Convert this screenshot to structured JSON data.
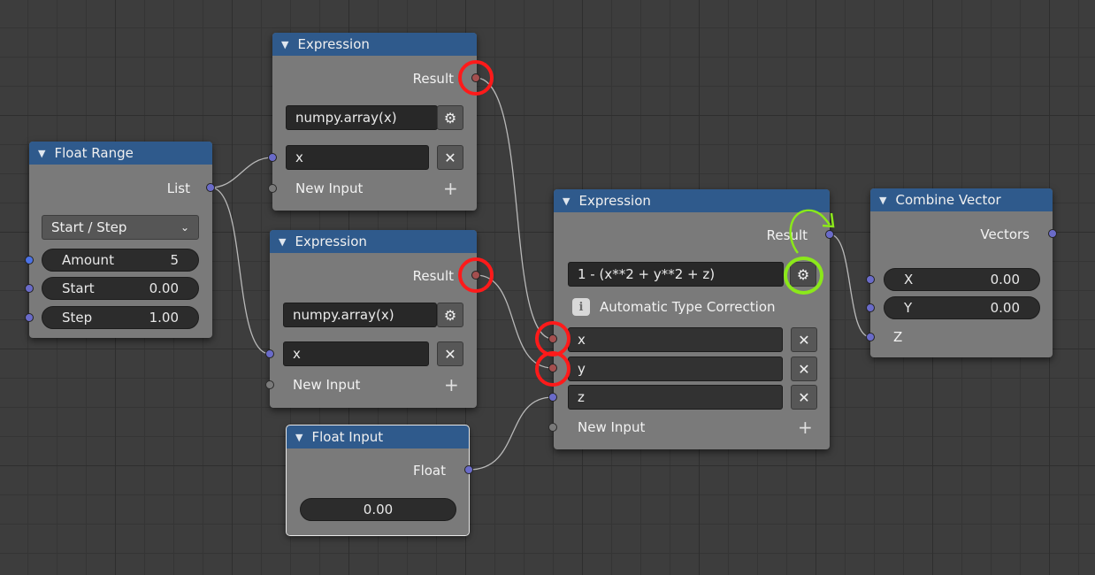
{
  "colors": {
    "header": "#2f5a8c",
    "node_body": "#7a7a7a",
    "socket_float": "#6a6bc9",
    "socket_red": "#a44f4f",
    "highlight_red": "#ff1a1a",
    "highlight_green": "#8be81a"
  },
  "float_range": {
    "title": "Float Range",
    "output_label": "List",
    "mode": "Start / Step",
    "amount_label": "Amount",
    "amount_value": "5",
    "start_label": "Start",
    "start_value": "0.00",
    "step_label": "Step",
    "step_value": "1.00"
  },
  "expr1": {
    "title": "Expression",
    "output_label": "Result",
    "expression": "numpy.array(x)",
    "input_name": "x",
    "new_input_label": "New Input"
  },
  "expr2": {
    "title": "Expression",
    "output_label": "Result",
    "expression": "numpy.array(x)",
    "input_name": "x",
    "new_input_label": "New Input"
  },
  "float_input": {
    "title": "Float Input",
    "output_label": "Float",
    "value": "0.00"
  },
  "expr3": {
    "title": "Expression",
    "output_label": "Result",
    "expression": "1 - (x**2 + y**2 + z)",
    "info_text": "Automatic Type Correction",
    "inputs": [
      "x",
      "y",
      "z"
    ],
    "new_input_label": "New Input"
  },
  "combine": {
    "title": "Combine Vector",
    "output_label": "Vectors",
    "x_label": "X",
    "x_value": "0.00",
    "y_label": "Y",
    "y_value": "0.00",
    "z_label": "Z"
  }
}
